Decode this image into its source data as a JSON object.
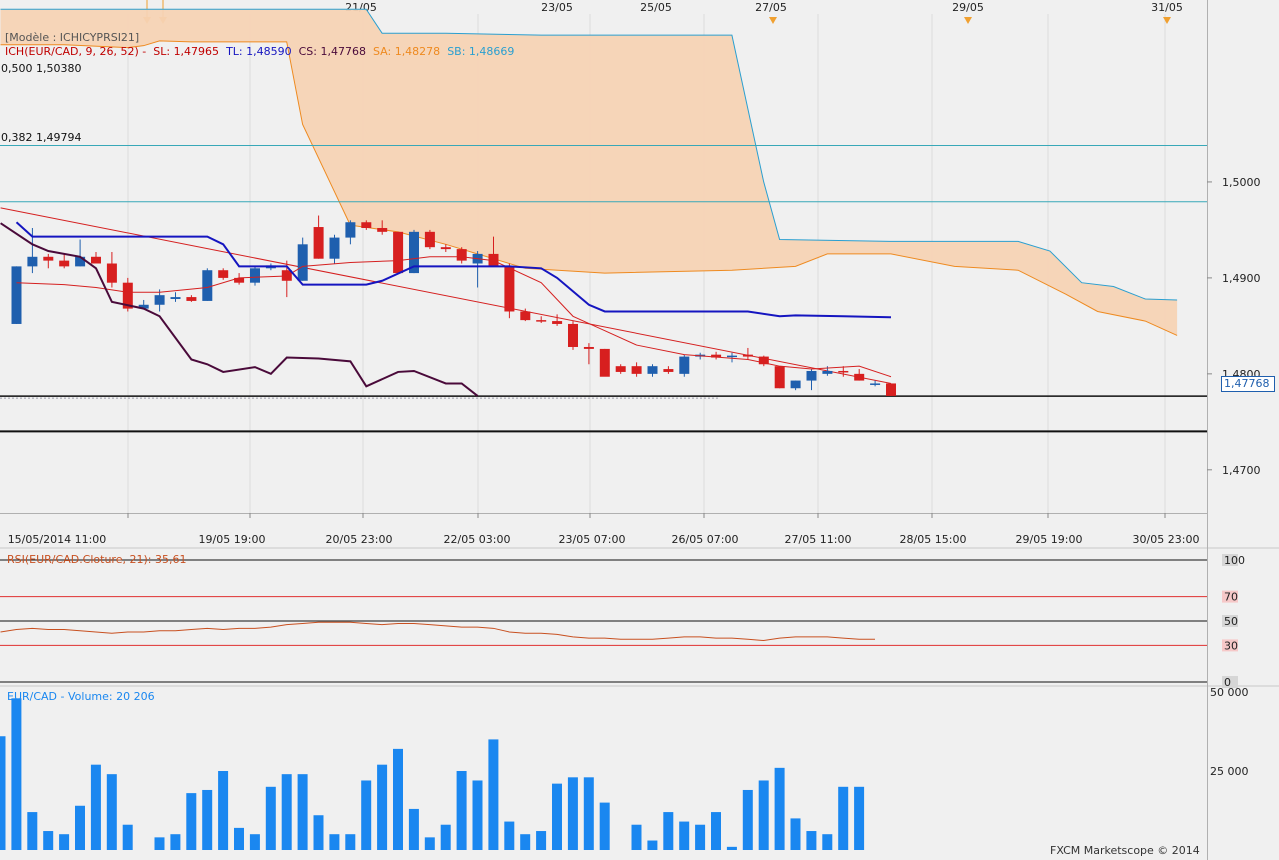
{
  "header": {
    "model_label": "[Modèle : ICHICYPRSI21]",
    "ichimoku": {
      "prefix": "ICH(EUR/CAD, 9, 26, 52) -",
      "sl": "SL: 1,47965",
      "tl": "TL: 1,48590",
      "cs": "CS: 1,47768",
      "sa": "SA: 1,48278",
      "sb": "SB: 1,48669"
    },
    "fib_500": "0,500 1,50380",
    "fib_382": "0,382 1,49794",
    "last_price": "1,47768",
    "rsi_label": "RSI(EUR/CAD.Cloture, 21): 35,61",
    "volume_label": "EUR/CAD - Volume: 20 206",
    "watermark": "FXCM Marketscope © 2014"
  },
  "colors": {
    "bull": "#1f5fae",
    "bear": "#d71f1f",
    "kijun": "#1515c0",
    "tenkan": "#d52020",
    "chikou": "#4a0a3a",
    "senkouA": "#ee8a20",
    "senkouB": "#2a9fd0",
    "cloud": "#f5d3b4",
    "volume": "#1a87f0",
    "rsi": "#c85020"
  },
  "chart_data": [
    {
      "type": "candlestick",
      "title": "EUR/CAD",
      "ylim": [
        1.4655,
        1.5175
      ],
      "y_ticks": [
        "1,5000",
        "1,4900",
        "1,4800",
        "1,4700"
      ],
      "x_ticks": [
        "15/05/2014 11:00",
        "19/05 19:00",
        "20/05 23:00",
        "22/05 03:00",
        "23/05 07:00",
        "26/05 07:00",
        "27/05 11:00",
        "28/05 15:00",
        "29/05 19:00",
        "30/05 23:00"
      ],
      "top_dates": [
        "21/05",
        "23/05",
        "25/05",
        "27/05",
        "29/05",
        "31/05"
      ],
      "candles": [
        [
          1.4852,
          1.4912,
          1.4852,
          1.4912
        ],
        [
          1.4912,
          1.4952,
          1.4905,
          1.4922
        ],
        [
          1.4922,
          1.4925,
          1.491,
          1.4918
        ],
        [
          1.4918,
          1.4925,
          1.491,
          1.4912
        ],
        [
          1.4912,
          1.494,
          1.4912,
          1.4922
        ],
        [
          1.4922,
          1.4927,
          1.4915,
          1.4915
        ],
        [
          1.4915,
          1.4927,
          1.489,
          1.4895
        ],
        [
          1.4895,
          1.49,
          1.4865,
          1.4868
        ],
        [
          1.4868,
          1.4877,
          1.4867,
          1.4872
        ],
        [
          1.4872,
          1.4888,
          1.4865,
          1.4882
        ],
        [
          1.4878,
          1.4885,
          1.4875,
          1.488
        ],
        [
          1.488,
          1.4882,
          1.4875,
          1.4876
        ],
        [
          1.4876,
          1.491,
          1.4876,
          1.4908
        ],
        [
          1.4908,
          1.491,
          1.4898,
          1.49
        ],
        [
          1.49,
          1.4905,
          1.4893,
          1.4895
        ],
        [
          1.4895,
          1.4912,
          1.4892,
          1.491
        ],
        [
          1.491,
          1.4915,
          1.4908,
          1.4913
        ],
        [
          1.4908,
          1.4918,
          1.488,
          1.4897
        ],
        [
          1.4897,
          1.4942,
          1.4897,
          1.4935
        ],
        [
          1.4953,
          1.4965,
          1.492,
          1.492
        ],
        [
          1.492,
          1.4945,
          1.4915,
          1.4942
        ],
        [
          1.4942,
          1.496,
          1.4935,
          1.4958
        ],
        [
          1.4958,
          1.496,
          1.495,
          1.4952
        ],
        [
          1.4952,
          1.496,
          1.4945,
          1.4948
        ],
        [
          1.4948,
          1.4948,
          1.4905,
          1.4905
        ],
        [
          1.4905,
          1.495,
          1.4905,
          1.4948
        ],
        [
          1.4948,
          1.495,
          1.493,
          1.4932
        ],
        [
          1.4932,
          1.4935,
          1.4927,
          1.493
        ],
        [
          1.493,
          1.4932,
          1.4915,
          1.4918
        ],
        [
          1.4915,
          1.4928,
          1.489,
          1.4925
        ],
        [
          1.4925,
          1.4943,
          1.4912,
          1.4912
        ],
        [
          1.4912,
          1.4915,
          1.4858,
          1.4865
        ],
        [
          1.4865,
          1.4868,
          1.4855,
          1.4856
        ],
        [
          1.4856,
          1.486,
          1.4853,
          1.4855
        ],
        [
          1.4855,
          1.4862,
          1.485,
          1.4852
        ],
        [
          1.4852,
          1.4855,
          1.4825,
          1.4828
        ],
        [
          1.4828,
          1.4832,
          1.481,
          1.4826
        ],
        [
          1.4826,
          1.4826,
          1.48,
          1.4797
        ],
        [
          1.4808,
          1.481,
          1.48,
          1.4802
        ],
        [
          1.4808,
          1.4812,
          1.4797,
          1.48
        ],
        [
          1.48,
          1.481,
          1.4797,
          1.4808
        ],
        [
          1.4805,
          1.4808,
          1.48,
          1.4802
        ],
        [
          1.48,
          1.482,
          1.4797,
          1.4818
        ],
        [
          1.4818,
          1.4822,
          1.4815,
          1.482
        ],
        [
          1.482,
          1.4823,
          1.4815,
          1.4817
        ],
        [
          1.4818,
          1.4822,
          1.4812,
          1.4819
        ],
        [
          1.482,
          1.4827,
          1.4815,
          1.4818
        ],
        [
          1.4818,
          1.4819,
          1.4808,
          1.481
        ],
        [
          1.4808,
          1.4808,
          1.4785,
          1.4785
        ],
        [
          1.4785,
          1.4793,
          1.4783,
          1.4793
        ],
        [
          1.4793,
          1.4805,
          1.4783,
          1.4803
        ],
        [
          1.48,
          1.4808,
          1.4798,
          1.4803
        ],
        [
          1.4803,
          1.4808,
          1.4797,
          1.4802
        ],
        [
          1.48,
          1.4805,
          1.4793,
          1.4793
        ],
        [
          1.479,
          1.4793,
          1.4787,
          1.479
        ],
        [
          1.479,
          1.479,
          1.4777,
          1.4777
        ]
      ],
      "kijun": [
        [
          0,
          1.4958
        ],
        [
          1,
          1.4943
        ],
        [
          2,
          1.4943
        ],
        [
          10,
          1.4943
        ],
        [
          12,
          1.4943
        ],
        [
          13,
          1.4935
        ],
        [
          14,
          1.4912
        ],
        [
          17,
          1.4912
        ],
        [
          18,
          1.4893
        ],
        [
          22,
          1.4893
        ],
        [
          23,
          1.4897
        ],
        [
          25,
          1.4912
        ],
        [
          31,
          1.4912
        ],
        [
          33,
          1.491
        ],
        [
          34,
          1.49
        ],
        [
          36,
          1.4872
        ],
        [
          37,
          1.4865
        ],
        [
          46,
          1.4865
        ],
        [
          48,
          1.486
        ],
        [
          49,
          1.4861
        ],
        [
          52,
          1.486
        ],
        [
          55,
          1.4859
        ]
      ],
      "tenkan": [
        [
          0,
          1.4895
        ],
        [
          3,
          1.4893
        ],
        [
          5,
          1.489
        ],
        [
          7,
          1.4885
        ],
        [
          9,
          1.4885
        ],
        [
          12,
          1.489
        ],
        [
          14,
          1.49
        ],
        [
          17,
          1.4902
        ],
        [
          18,
          1.4912
        ],
        [
          21,
          1.4916
        ],
        [
          24,
          1.4918
        ],
        [
          26,
          1.4922
        ],
        [
          28,
          1.4922
        ],
        [
          30,
          1.4918
        ],
        [
          33,
          1.4895
        ],
        [
          35,
          1.486
        ],
        [
          37,
          1.4845
        ],
        [
          39,
          1.483
        ],
        [
          42,
          1.482
        ],
        [
          46,
          1.4815
        ],
        [
          48,
          1.4808
        ],
        [
          50,
          1.4805
        ],
        [
          53,
          1.4808
        ],
        [
          55,
          1.4797
        ]
      ],
      "chikou": [
        [
          -1,
          1.4957
        ],
        [
          1,
          1.4935
        ],
        [
          2,
          1.4928
        ],
        [
          4,
          1.4922
        ],
        [
          5,
          1.491
        ],
        [
          6,
          1.4875
        ],
        [
          8,
          1.4868
        ],
        [
          9,
          1.486
        ],
        [
          11,
          1.4815
        ],
        [
          12,
          1.481
        ],
        [
          13,
          1.4802
        ],
        [
          15,
          1.4807
        ],
        [
          16,
          1.48
        ],
        [
          17,
          1.4817
        ],
        [
          19,
          1.4816
        ],
        [
          21,
          1.4813
        ],
        [
          22,
          1.4787
        ],
        [
          24,
          1.4802
        ],
        [
          25,
          1.4803
        ],
        [
          27,
          1.479
        ],
        [
          28,
          1.479
        ],
        [
          29,
          1.4777
        ]
      ],
      "senkou_a": [
        [
          0,
          1.5143
        ],
        [
          4,
          1.5143
        ],
        [
          8,
          1.514
        ],
        [
          9,
          1.5142
        ],
        [
          10,
          1.5147
        ],
        [
          12,
          1.5146
        ],
        [
          18,
          1.5146
        ],
        [
          19,
          1.506
        ],
        [
          21,
          1.499
        ],
        [
          22,
          1.4955
        ],
        [
          25,
          1.4948
        ],
        [
          28,
          1.4935
        ],
        [
          33,
          1.491
        ],
        [
          38,
          1.4905
        ],
        [
          46,
          1.4908
        ],
        [
          50,
          1.4912
        ],
        [
          52,
          1.4925
        ],
        [
          56,
          1.4925
        ],
        [
          60,
          1.4912
        ],
        [
          64,
          1.4908
        ],
        [
          67,
          1.4883
        ],
        [
          69,
          1.4865
        ],
        [
          72,
          1.4855
        ],
        [
          74,
          1.484
        ]
      ],
      "senkou_b": [
        [
          0,
          1.518
        ],
        [
          23,
          1.518
        ],
        [
          24,
          1.5155
        ],
        [
          28,
          1.5155
        ],
        [
          34,
          1.5153
        ],
        [
          41,
          1.5153
        ],
        [
          46,
          1.5153
        ],
        [
          48,
          1.5
        ],
        [
          49,
          1.494
        ],
        [
          56,
          1.4938
        ],
        [
          64,
          1.4938
        ],
        [
          66,
          1.4928
        ],
        [
          68,
          1.4895
        ],
        [
          70,
          1.4891
        ],
        [
          72,
          1.4878
        ],
        [
          74,
          1.4877
        ]
      ],
      "trendline": [
        [
          -1,
          1.4973
        ],
        [
          55,
          1.479
        ]
      ],
      "fib_500": 1.5038,
      "fib_382": 1.49794,
      "support_1": 1.47768,
      "support_2": 1.474
    },
    {
      "type": "line",
      "title": "RSI(EUR/CAD.Cloture, 21): 35,61",
      "ylim": [
        0,
        100
      ],
      "levels": [
        100,
        70,
        50,
        30,
        0
      ],
      "values": [
        41,
        43,
        44,
        43,
        43,
        42,
        41,
        40,
        41,
        41,
        42,
        42,
        43,
        44,
        43,
        44,
        44,
        45,
        47,
        48,
        49,
        49,
        49,
        48,
        47,
        48,
        48,
        47,
        46,
        45,
        45,
        44,
        41,
        40,
        40,
        39,
        37,
        36,
        36,
        35,
        35,
        35,
        36,
        37,
        37,
        36,
        36,
        35,
        34,
        36,
        37,
        37,
        37,
        36,
        35,
        35
      ]
    },
    {
      "type": "bar",
      "title": "EUR/CAD - Volume: 20 206",
      "ylim": [
        0,
        50000
      ],
      "y_ticks": [
        "50 000",
        "25 000"
      ],
      "values": [
        36000,
        48000,
        12000,
        6000,
        5000,
        14000,
        27000,
        24000,
        8000,
        0,
        4000,
        5000,
        18000,
        19000,
        25000,
        7000,
        5000,
        20000,
        24000,
        24000,
        11000,
        5000,
        5000,
        22000,
        27000,
        32000,
        13000,
        4000,
        8000,
        25000,
        22000,
        35000,
        9000,
        5000,
        6000,
        21000,
        23000,
        23000,
        15000,
        0,
        8000,
        3000,
        12000,
        9000,
        8000,
        12000,
        1000,
        19000,
        22000,
        26000,
        10000,
        6000,
        5000,
        20000,
        20000
      ]
    }
  ]
}
